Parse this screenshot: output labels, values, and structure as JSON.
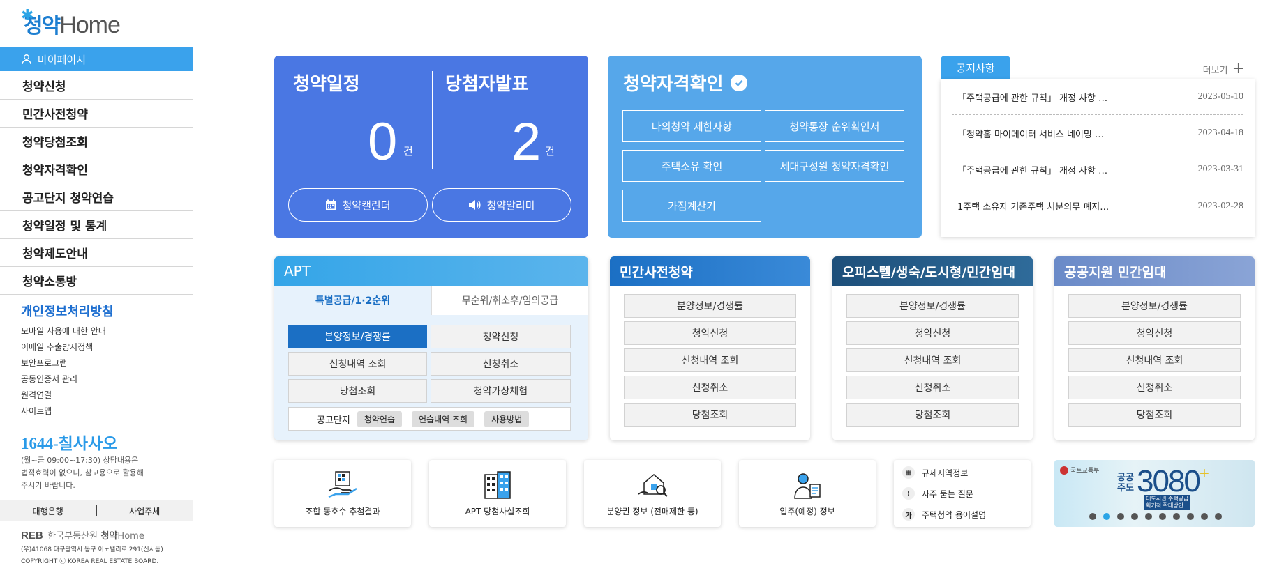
{
  "sidebar": {
    "logo_ko": "청약",
    "logo_en": "Home",
    "mypage": "마이페이지",
    "nav": [
      "청약신청",
      "민간사전청약",
      "청약당첨조회",
      "청약자격확인",
      "공고단지 청약연습",
      "청약일정 및 통계",
      "청약제도안내",
      "청약소통방"
    ],
    "privacy": "개인정보처리방침",
    "links": [
      "모바일 사용에 대한 안내",
      "이메일 추출방지정책",
      "보안프로그램",
      "공동인증서 관리",
      "원격연결",
      "사이트맵"
    ],
    "phone_num": "1644-",
    "phone_word": "칠사사오",
    "hours": [
      "(월~금 09:00~17:30) 상담내용은",
      "법적효력이 없으니, 참고용으로 활용해",
      "주시기 바랍니다."
    ],
    "bank": "대행은행",
    "biz": "사업주체",
    "reb": "한국부동산원",
    "reb_logo": "REB",
    "reb_ko": "청약",
    "reb_en": "Home",
    "address": "(우)41068 대구광역시 동구 이노밸리로 291(신서동)",
    "copyright": "COPYRIGHT ⓒ KOREA REAL ESTATE BOARD."
  },
  "schedule": {
    "title": "청약일정",
    "count": "0",
    "unit": "건",
    "calendar_btn": "청약캘린더"
  },
  "winners": {
    "title": "당첨자발표",
    "count": "2",
    "unit": "건",
    "alarm_btn": "청약알리미"
  },
  "qualification": {
    "title": "청약자격확인",
    "buttons": [
      "나의청약 제한사항",
      "청약통장 순위확인서",
      "주택소유 확인",
      "세대구성원 청약자격확인",
      "가점계산기"
    ]
  },
  "notice": {
    "tab": "공지사항",
    "more": "더보기",
    "items": [
      {
        "title": "「주택공급에 관한 규칙」 개정 사항 …",
        "date": "2023-05-10"
      },
      {
        "title": "「청약홈 마이데이터 서비스 네이밍 …",
        "date": "2023-04-18"
      },
      {
        "title": "「주택공급에 관한 규칙」 개정 사항 …",
        "date": "2023-03-31"
      },
      {
        "title": "1주택 소유자 기존주택 처분의무 폐지…",
        "date": "2023-02-28"
      }
    ]
  },
  "apt": {
    "title": "APT",
    "tabs": [
      "특별공급/1·2순위",
      "무순위/취소후/임의공급"
    ],
    "buttons": [
      "분양정보/경쟁률",
      "청약신청",
      "신청내역 조회",
      "신청취소",
      "당첨조회",
      "청약가상체험"
    ],
    "practice_label": "공고단지",
    "chips": [
      "청약연습",
      "연습내역 조회",
      "사용방법"
    ]
  },
  "panels": [
    {
      "title": "민간사전청약",
      "buttons": [
        "분양정보/경쟁률",
        "청약신청",
        "신청내역 조회",
        "신청취소",
        "당첨조회"
      ]
    },
    {
      "title": "오피스텔/생숙/도시형/민간임대",
      "buttons": [
        "분양정보/경쟁률",
        "청약신청",
        "신청내역 조회",
        "신청취소",
        "당첨조회"
      ]
    },
    {
      "title": "공공지원 민간임대",
      "buttons": [
        "분양정보/경쟁률",
        "청약신청",
        "신청내역 조회",
        "신청취소",
        "당첨조회"
      ]
    }
  ],
  "quick": [
    "조합 동호수 추첨결과",
    "APT 당첨사실조회",
    "분양권 정보 (전매제한 등)",
    "입주(예정) 정보"
  ],
  "links3": [
    {
      "icon": "building-icon",
      "label": "규제지역정보"
    },
    {
      "icon": "exclamation-icon",
      "label": "자주 묻는 질문"
    },
    {
      "icon": "dictionary-icon",
      "label": "주택청약 용어설명"
    }
  ],
  "banner": {
    "org": "국토교통부",
    "a": "공공",
    "b": "주도",
    "num": "3080",
    "plus": "+",
    "sub1": "대도시권 주택공급",
    "sub2": "획기적 확대방안"
  },
  "colors": {
    "primary": "#3aa2ec",
    "schedule_bg": "#4a77e3",
    "qual_bg": "#56a7ea",
    "dark_blue": "#1b6fc4"
  }
}
